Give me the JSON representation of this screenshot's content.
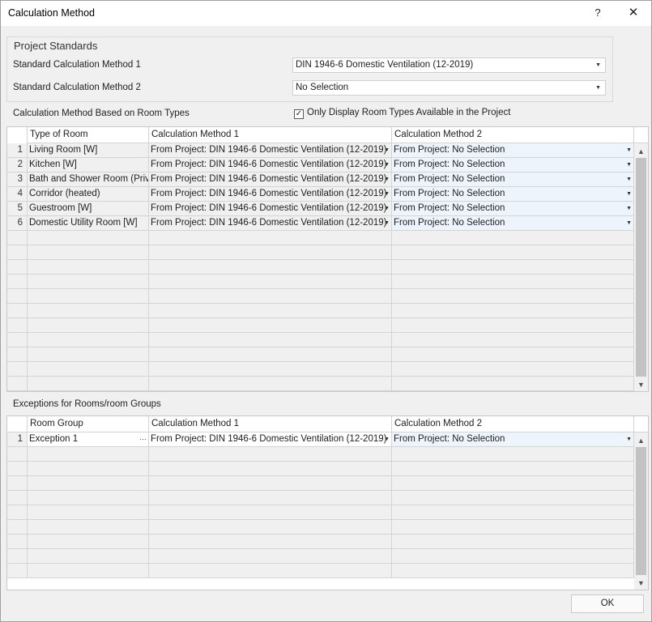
{
  "window": {
    "title": "Calculation Method",
    "help_glyph": "?",
    "close_glyph": "✕"
  },
  "project_standards": {
    "title": "Project Standards",
    "method1_label": "Standard Calculation Method 1",
    "method1_value": "DIN 1946-6 Domestic Ventilation (12-2019)",
    "method2_label": "Standard Calculation Method 2",
    "method2_value": "No Selection"
  },
  "room_types": {
    "section_label": "Calculation Method Based on Room Types",
    "filter_checkbox": {
      "label": "Only Display Room Types Available in the Project",
      "checked": true,
      "glyph": "✓"
    },
    "columns": [
      "Type of Room",
      "Calculation Method 1",
      "Calculation Method 2"
    ],
    "rows": [
      {
        "num": "1",
        "room": "Living Room [W]",
        "m1": "From Project: DIN 1946-6 Domestic Ventilation (12-2019)",
        "m2": "From Project: No Selection"
      },
      {
        "num": "2",
        "room": "Kitchen [W]",
        "m1": "From Project: DIN 1946-6 Domestic Ventilation (12-2019)",
        "m2": "From Project: No Selection"
      },
      {
        "num": "3",
        "room": "Bath and Shower Room (Priv...",
        "m1": "From Project: DIN 1946-6 Domestic Ventilation (12-2019)",
        "m2": "From Project: No Selection"
      },
      {
        "num": "4",
        "room": "Corridor (heated)",
        "m1": "From Project: DIN 1946-6 Domestic Ventilation (12-2019)",
        "m2": "From Project: No Selection"
      },
      {
        "num": "5",
        "room": "Guestroom [W]",
        "m1": "From Project: DIN 1946-6 Domestic Ventilation (12-2019)",
        "m2": "From Project: No Selection"
      },
      {
        "num": "6",
        "room": "Domestic Utility Room [W]",
        "m1": "From Project: DIN 1946-6 Domestic Ventilation (12-2019)",
        "m2": "From Project: No Selection"
      }
    ]
  },
  "exceptions": {
    "section_label": "Exceptions for Rooms/room Groups",
    "columns": [
      "Room Group",
      "Calculation Method 1",
      "Calculation Method 2"
    ],
    "rows": [
      {
        "num": "1",
        "group": "Exception 1",
        "ellipsis": "···",
        "m1": "From Project: DIN 1946-6 Domestic Ventilation (12-2019)",
        "m2": "From Project: No Selection"
      }
    ]
  },
  "icons": {
    "dropdown": "chevron-down-icon",
    "scroll_up": "chevron-up-icon",
    "scroll_down": "chevron-down-icon"
  },
  "glyphs": {
    "dropdown": "▼",
    "up": "▲",
    "down": "▼"
  },
  "footer": {
    "ok_label": "OK"
  },
  "colors": {
    "row_bg": "#f0f0f0",
    "method2_bg": "#eef4fb",
    "grid_line": "#d4d4d4"
  }
}
